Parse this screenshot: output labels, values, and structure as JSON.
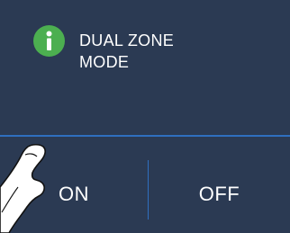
{
  "dialog": {
    "title": "DUAL ZONE\nMODE",
    "icon": "info-icon"
  },
  "buttons": {
    "on_label": "ON",
    "off_label": "OFF"
  },
  "colors": {
    "background": "#2b3a53",
    "accent_green": "#4caf50",
    "divider_blue": "#2f6fbf",
    "text": "#ffffff"
  }
}
